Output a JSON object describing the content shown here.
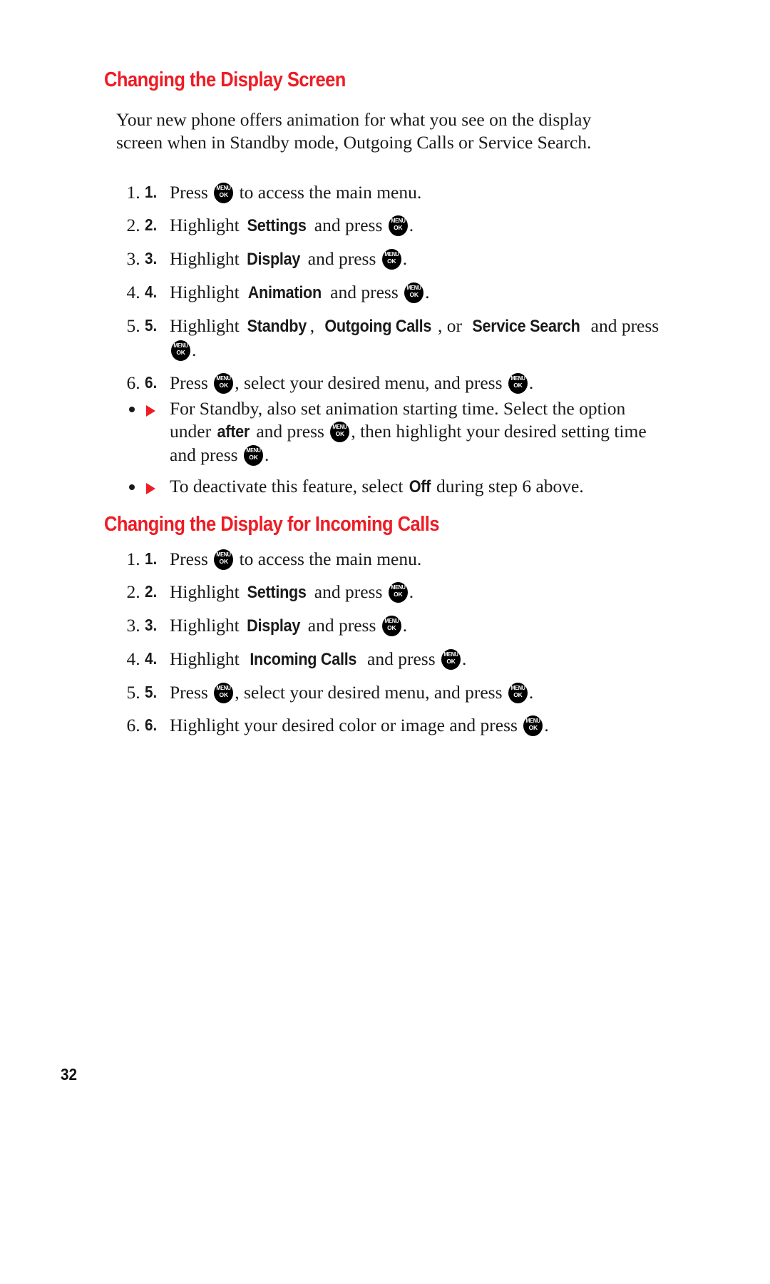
{
  "page": {
    "number": "32",
    "accent_color": "#ee1c25",
    "text_color": "#1a1a1a",
    "background": "#ffffff"
  },
  "menu_key": {
    "top_label": "MENU",
    "bottom_label": "OK",
    "icon_name": "menu-ok-key-icon"
  },
  "bullet_marker": {
    "glyph": "▶",
    "color": "#ee1c25"
  },
  "sections": [
    {
      "id": "changing-the-display-screen",
      "heading": "Changing the Display Screen",
      "intro": "Your new phone offers animation for what you see on the display screen when in Standby mode, Outgoing Calls or Service Search.",
      "steps": [
        {
          "number": "1.",
          "parts": [
            {
              "type": "text",
              "value": "Press "
            },
            {
              "type": "key"
            },
            {
              "type": "text",
              "value": " to access the main menu."
            }
          ],
          "plain": "Press [MENU OK] to access the main menu."
        },
        {
          "number": "2.",
          "parts": [
            {
              "type": "text",
              "value": "Highlight "
            },
            {
              "type": "em",
              "value": "Settings"
            },
            {
              "type": "text",
              "value": " and press "
            },
            {
              "type": "key"
            },
            {
              "type": "text",
              "value": "."
            }
          ],
          "plain": "Highlight Settings and press [MENU OK]."
        },
        {
          "number": "3.",
          "parts": [
            {
              "type": "text",
              "value": "Highlight "
            },
            {
              "type": "em",
              "value": "Display"
            },
            {
              "type": "text",
              "value": " and press "
            },
            {
              "type": "key"
            },
            {
              "type": "text",
              "value": "."
            }
          ],
          "plain": "Highlight Display and press [MENU OK]."
        },
        {
          "number": "4.",
          "parts": [
            {
              "type": "text",
              "value": "Highlight "
            },
            {
              "type": "em",
              "value": "Animation"
            },
            {
              "type": "text",
              "value": " and press "
            },
            {
              "type": "key"
            },
            {
              "type": "text",
              "value": "."
            }
          ],
          "plain": "Highlight Animation and press [MENU OK]."
        },
        {
          "number": "5.",
          "parts": [
            {
              "type": "text",
              "value": "Highlight "
            },
            {
              "type": "em",
              "value": "Standby"
            },
            {
              "type": "text",
              "value": ", "
            },
            {
              "type": "em",
              "value": "Outgoing Calls"
            },
            {
              "type": "text",
              "value": ", or "
            },
            {
              "type": "em",
              "value": "Service Search"
            },
            {
              "type": "text",
              "value": " and press "
            },
            {
              "type": "key"
            },
            {
              "type": "text",
              "value": "."
            }
          ],
          "plain": "Highlight Standby, Outgoing Calls, or Service Search and press [MENU OK]."
        },
        {
          "number": "6.",
          "parts": [
            {
              "type": "text",
              "value": "Press "
            },
            {
              "type": "key"
            },
            {
              "type": "text",
              "value": ", select your desired menu, and press "
            },
            {
              "type": "key"
            },
            {
              "type": "text",
              "value": "."
            }
          ],
          "plain": "Press [MENU OK], select your desired menu, and press [MENU OK]."
        }
      ],
      "bullets": [
        {
          "parts": [
            {
              "type": "text",
              "value": "For Standby, also set animation starting time. Select the option under "
            },
            {
              "type": "em",
              "value": "after"
            },
            {
              "type": "text",
              "value": " and press "
            },
            {
              "type": "key"
            },
            {
              "type": "text",
              "value": ", then highlight your desired setting time and press "
            },
            {
              "type": "key"
            },
            {
              "type": "text",
              "value": "."
            }
          ],
          "plain": "For Standby, also set animation starting time. Select the option under after and press [MENU OK], then highlight your desired setting time and press [MENU OK]."
        },
        {
          "parts": [
            {
              "type": "text",
              "value": "To deactivate this feature, select "
            },
            {
              "type": "em",
              "value": "Off"
            },
            {
              "type": "text",
              "value": " during step 6 above."
            }
          ],
          "plain": "To deactivate this feature, select Off during step 6 above."
        }
      ]
    },
    {
      "id": "changing-the-display-for-incoming-calls",
      "heading": "Changing the Display for Incoming Calls",
      "intro": "",
      "steps": [
        {
          "number": "1.",
          "parts": [
            {
              "type": "text",
              "value": "Press "
            },
            {
              "type": "key"
            },
            {
              "type": "text",
              "value": " to access the main menu."
            }
          ],
          "plain": "Press [MENU OK] to access the main menu."
        },
        {
          "number": "2.",
          "parts": [
            {
              "type": "text",
              "value": "Highlight "
            },
            {
              "type": "em",
              "value": "Settings"
            },
            {
              "type": "text",
              "value": " and press "
            },
            {
              "type": "key"
            },
            {
              "type": "text",
              "value": "."
            }
          ],
          "plain": "Highlight Settings and press [MENU OK]."
        },
        {
          "number": "3.",
          "parts": [
            {
              "type": "text",
              "value": "Highlight "
            },
            {
              "type": "em",
              "value": "Display"
            },
            {
              "type": "text",
              "value": " and press "
            },
            {
              "type": "key"
            },
            {
              "type": "text",
              "value": "."
            }
          ],
          "plain": "Highlight Display and press [MENU OK]."
        },
        {
          "number": "4.",
          "parts": [
            {
              "type": "text",
              "value": "Highlight "
            },
            {
              "type": "em",
              "value": "Incoming Calls"
            },
            {
              "type": "text",
              "value": " and press "
            },
            {
              "type": "key"
            },
            {
              "type": "text",
              "value": "."
            }
          ],
          "plain": "Highlight Incoming Calls and press [MENU OK]."
        },
        {
          "number": "5.",
          "parts": [
            {
              "type": "text",
              "value": "Press "
            },
            {
              "type": "key"
            },
            {
              "type": "text",
              "value": ", select your desired menu, and press "
            },
            {
              "type": "key"
            },
            {
              "type": "text",
              "value": "."
            }
          ],
          "plain": "Press [MENU OK], select your desired menu, and press [MENU OK]."
        },
        {
          "number": "6.",
          "parts": [
            {
              "type": "text",
              "value": "Highlight your desired color or image and press "
            },
            {
              "type": "key"
            },
            {
              "type": "text",
              "value": "."
            }
          ],
          "plain": "Highlight your desired color or image and press [MENU OK]."
        }
      ],
      "bullets": []
    }
  ]
}
